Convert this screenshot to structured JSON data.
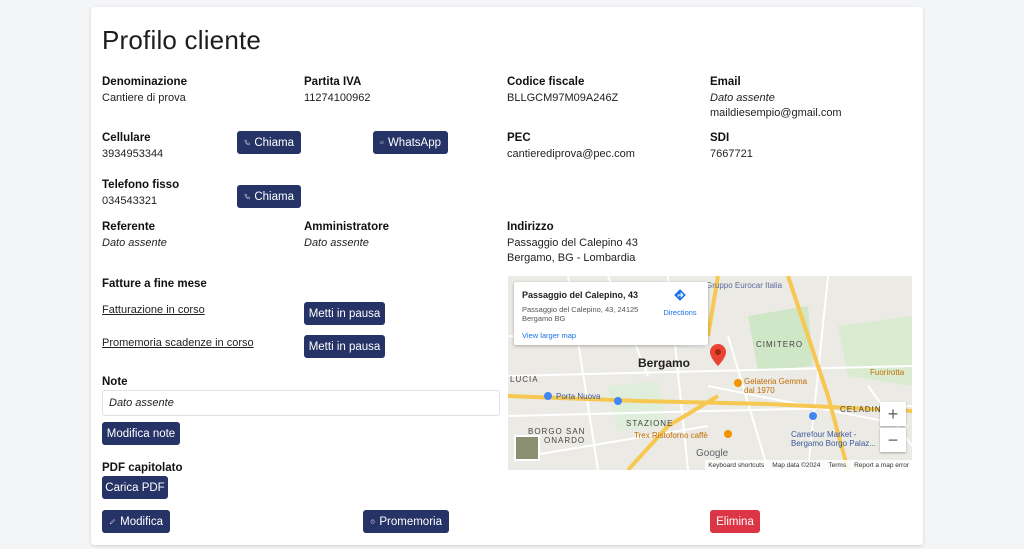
{
  "page": {
    "title": "Profilo cliente"
  },
  "fields": {
    "denominazione": {
      "label": "Denominazione",
      "value": "Cantiere di prova"
    },
    "partita_iva": {
      "label": "Partita IVA",
      "value": "11274100962"
    },
    "codice_fiscale": {
      "label": "Codice fiscale",
      "value": "BLLGCM97M09A246Z"
    },
    "email": {
      "label": "Email",
      "value_missing": "Dato assente",
      "value": "maildiesempio@gmail.com"
    },
    "cellulare": {
      "label": "Cellulare",
      "value": "3934953344"
    },
    "pec": {
      "label": "PEC",
      "value": "cantierediprova@pec.com"
    },
    "sdi": {
      "label": "SDI",
      "value": "7667721"
    },
    "telefono_fisso": {
      "label": "Telefono fisso",
      "value": "034543321"
    },
    "referente": {
      "label": "Referente",
      "value": "Dato assente"
    },
    "amministratore": {
      "label": "Amministratore",
      "value": "Dato assente"
    },
    "indirizzo": {
      "label": "Indirizzo",
      "line1": "Passaggio del Calepino 43",
      "line2": "Bergamo, BG - Lombardia"
    }
  },
  "buttons": {
    "chiama": "Chiama",
    "whatsapp": "WhatsApp",
    "metti_in_pausa": "Metti in pausa",
    "modifica_note": "Modifica note",
    "carica_pdf": "Carica PDF",
    "modifica": "Modifica",
    "promemoria": "Promemoria",
    "elimina": "Elimina"
  },
  "fatture": {
    "label": "Fatture a fine mese",
    "fatturazione": "Fatturazione in corso",
    "promemoria_scadenze": "Promemoria scadenze in corso"
  },
  "note": {
    "label": "Note",
    "value": "Dato assente"
  },
  "pdf": {
    "label": "PDF capitolato"
  },
  "map": {
    "info_title": "Passaggio del Calepino, 43",
    "info_addr1": "Passaggio del Calepino, 43, 24125",
    "info_addr2": "Bergamo BG",
    "directions": "Directions",
    "view_larger": "View larger map",
    "city": "Bergamo",
    "labels": {
      "gruppo": "Gruppo Eurocar Italia",
      "cimitero": "CIMITERO",
      "gelateria": "Gelateria Gemma",
      "gelateria2": "dal 1970",
      "fuorirotta": "Fuorirotta",
      "portanuova": "Porta Nuova",
      "stazione": "STAZIONE",
      "trex": "Trex Ristoforno caffè",
      "carrefour": "Carrefour Market -",
      "carrefour2": "Bergamo Borgo Palaz...",
      "celadin": "CELADIN",
      "lucia": "LUCIA",
      "borgo": "BORGO SAN",
      "onardo": "ONARDO",
      "google": "Google"
    },
    "footer": {
      "shortcuts": "Keyboard shortcuts",
      "data": "Map data ©2024",
      "terms": "Terms",
      "report": "Report a map error"
    },
    "zoom_in": "+",
    "zoom_out": "−",
    "colors": {
      "park": "#cfe6c7",
      "road": "#ffffff",
      "highway": "#f6c851",
      "pin": "#ea4335"
    }
  },
  "colors": {
    "primary": "#263366",
    "danger": "#dc3545"
  }
}
